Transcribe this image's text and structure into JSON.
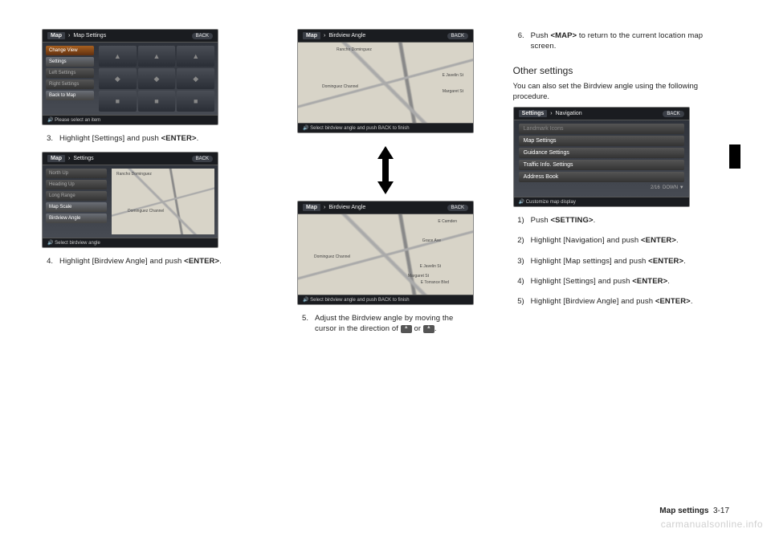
{
  "col1": {
    "ss1": {
      "crumb_prefix": "Map",
      "crumb": "Map Settings",
      "back": "BACK",
      "menu": [
        "Change View",
        "Settings",
        "Left Settings",
        "Right Settings",
        "Back to Map"
      ],
      "grid_icons": [
        "▲",
        "▲",
        "▲",
        "◆",
        "◆",
        "◆",
        "■",
        "■",
        "■"
      ],
      "footer": "Please select an item"
    },
    "step3": {
      "num": "3.",
      "text_a": "Highlight [Settings] and push ",
      "bold": "<ENTER>",
      "text_b": "."
    },
    "ss2": {
      "crumb_prefix": "Map",
      "crumb": "Settings",
      "back": "BACK",
      "menu": [
        "North Up",
        "Heading Up",
        "Long Range",
        "Map Scale",
        "Birdview Angle"
      ],
      "map_label1": "Rancho Dominguez",
      "map_label2": "Dominguez Channel",
      "footer": "Select birdview angle"
    },
    "step4": {
      "num": "4.",
      "text_a": "Highlight [Birdview Angle] and push ",
      "bold": "<ENTER>",
      "text_b": "."
    }
  },
  "col2": {
    "ss3": {
      "crumb_prefix": "Map",
      "crumb": "Birdview Angle",
      "back": "BACK",
      "map_labels": [
        "Rancho Dominguez",
        "Dominguez Channel",
        "E Javelin St",
        "Margaret St"
      ],
      "footer": "Select birdview angle and push BACK to finish"
    },
    "ss4": {
      "crumb_prefix": "Map",
      "crumb": "Birdview Angle",
      "back": "BACK",
      "map_labels": [
        "E Camden",
        "Dominguez Channel",
        "E Javelin St",
        "E Torrance Blvd",
        "Grace Ave",
        "Margaret St"
      ],
      "footer": "Select birdview angle and push BACK to finish"
    },
    "step5": {
      "num": "5.",
      "text_a": "Adjust the Birdview angle by moving the cursor in the direction of ",
      "text_b": " or ",
      "text_c": "."
    }
  },
  "col3": {
    "step6": {
      "num": "6.",
      "text_a": "Push ",
      "bold": "<MAP>",
      "text_b": " to return to the current location map screen."
    },
    "other_title": "Other settings",
    "other_intro": "You can also set the Birdview angle using the following procedure.",
    "ss5": {
      "crumb_prefix": "Settings",
      "crumb": "Navigation",
      "back": "BACK",
      "items": [
        "Landmark Icons",
        "Map Settings",
        "Guidance Settings",
        "Traffic Info. Settings",
        "Address Book"
      ],
      "counter": "2/16",
      "down": "DOWN ▼",
      "footer": "Customize map display"
    },
    "proc": [
      {
        "num": "1)",
        "text_a": "Push ",
        "bold": "<SETTING>",
        "text_b": "."
      },
      {
        "num": "2)",
        "text_a": "Highlight [Navigation] and push ",
        "bold": "<ENTER>",
        "text_b": "."
      },
      {
        "num": "3)",
        "text_a": "Highlight [Map settings] and push ",
        "bold": "<ENTER>",
        "text_b": "."
      },
      {
        "num": "4)",
        "text_a": "Highlight [Settings] and push ",
        "bold": "<ENTER>",
        "text_b": "."
      },
      {
        "num": "5)",
        "text_a": "Highlight [Birdview Angle] and push ",
        "bold": "<ENTER>",
        "text_b": "."
      }
    ]
  },
  "footer": {
    "label": "Map settings",
    "page": "3-17"
  },
  "watermark": "carmanualsonline.info"
}
